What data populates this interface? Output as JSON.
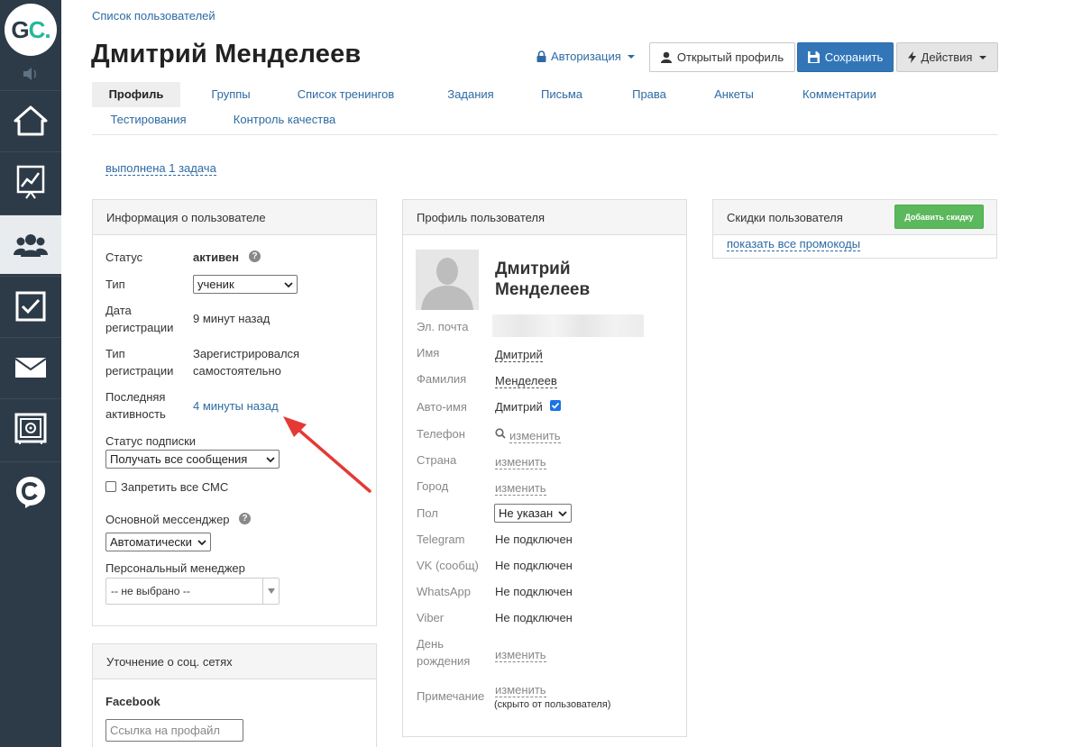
{
  "logo": {
    "text_main": "G",
    "text_accent": "C.",
    "accent_color": "#22b89a"
  },
  "sidebar": {
    "items": [
      {
        "name": "home-icon"
      },
      {
        "name": "chart-board-icon"
      },
      {
        "name": "users-icon",
        "active": true
      },
      {
        "name": "checkbox-icon"
      },
      {
        "name": "mail-icon"
      },
      {
        "name": "safe-icon"
      },
      {
        "name": "chat-c-icon"
      }
    ]
  },
  "header": {
    "breadcrumb": "Список пользователей",
    "title": "Дмитрий Менделеев",
    "auth_label": "Авторизация",
    "open_profile_label": "Открытый профиль",
    "save_label": "Сохранить",
    "actions_label": "Действия"
  },
  "tabs": [
    {
      "label": "Профиль",
      "active": true
    },
    {
      "label": "Группы"
    },
    {
      "label": "Список тренингов"
    },
    {
      "label": "Задания"
    },
    {
      "label": "Письма"
    },
    {
      "label": "Права"
    },
    {
      "label": "Анкеты"
    },
    {
      "label": "Комментарии"
    },
    {
      "label": "Тестирования"
    },
    {
      "label": "Контроль качества"
    }
  ],
  "task_link": "выполнена 1 задача",
  "user_info": {
    "title": "Информация о пользователе",
    "status_label": "Статус",
    "status_value": "активен",
    "type_label": "Тип",
    "type_value": "ученик",
    "reg_date_label_1": "Дата",
    "reg_date_label_2": "регистрации",
    "reg_date_value": "9 минут назад",
    "reg_type_label_1": "Тип",
    "reg_type_label_2": "регистрации",
    "reg_type_value_1": "Зарегистрировался",
    "reg_type_value_2": "самостоятельно",
    "last_activity_label_1": "Последняя",
    "last_activity_label_2": "активность",
    "last_activity_value": "4 минуты назад",
    "subscription_label": "Статус подписки",
    "subscription_value": "Получать все сообщения",
    "sms_label": "Запретить все СМС",
    "messenger_label": "Основной мессенджер",
    "messenger_value": "Автоматически",
    "manager_label": "Персональный менеджер",
    "manager_value": "-- не выбрано --"
  },
  "social": {
    "title": "Уточнение о соц. сетях",
    "facebook_label": "Facebook",
    "facebook_placeholder": "Ссылка на профайл"
  },
  "profile": {
    "title": "Профиль пользователя",
    "name_line_1": "Дмитрий",
    "name_line_2": "Менделеев",
    "email_label": "Эл. почта",
    "first_name_label": "Имя",
    "first_name_value": "Дмитрий",
    "last_name_label": "Фамилия",
    "last_name_value": "Менделеев",
    "auto_name_label": "Авто-имя",
    "auto_name_value": "Дмитрий",
    "phone_label": "Телефон",
    "phone_value": "изменить",
    "country_label": "Страна",
    "country_value": "изменить",
    "city_label": "Город",
    "city_value": "изменить",
    "gender_label": "Пол",
    "gender_value": "Не указан",
    "telegram_label": "Telegram",
    "telegram_value": "Не подключен",
    "vk_label": "VK (сообщ)",
    "vk_value": "Не подключен",
    "whatsapp_label": "WhatsApp",
    "whatsapp_value": "Не подключен",
    "viber_label": "Viber",
    "viber_value": "Не подключен",
    "birthday_label_1": "День",
    "birthday_label_2": "рождения",
    "birthday_value": "изменить",
    "note_label": "Примечание",
    "note_value": "изменить",
    "note_hint": "(скрыто от пользователя)"
  },
  "discounts": {
    "title": "Скидки пользователя",
    "add_button": "Добавить скидку",
    "promo_link": "показать все промокоды"
  }
}
